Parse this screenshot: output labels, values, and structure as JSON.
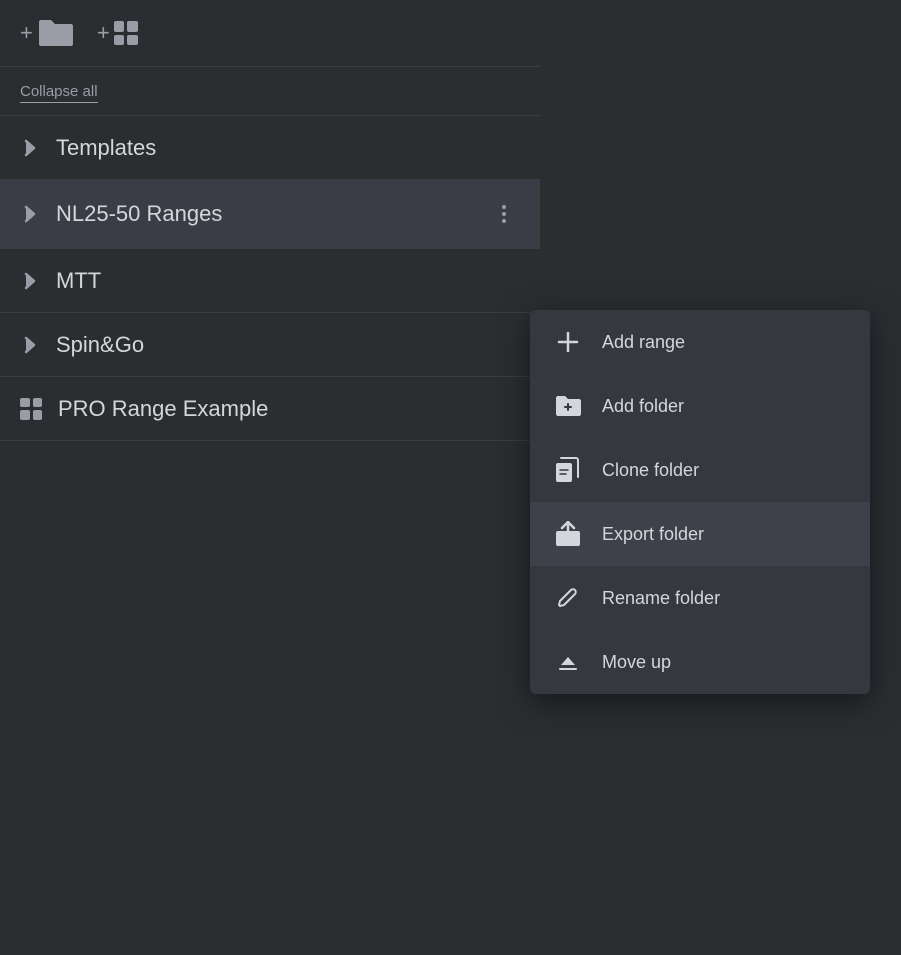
{
  "toolbar": {
    "add_folder_label": "+",
    "add_grid_label": "+"
  },
  "collapse_all": {
    "label": "Collapse all"
  },
  "nav_items": [
    {
      "id": "templates",
      "type": "chevron",
      "label": "Templates",
      "active": false,
      "show_more": false
    },
    {
      "id": "nl25-50",
      "type": "chevron",
      "label": "NL25-50 Ranges",
      "active": true,
      "show_more": true
    },
    {
      "id": "mtt",
      "type": "chevron",
      "label": "MTT",
      "active": false,
      "show_more": false
    },
    {
      "id": "spingo",
      "type": "chevron",
      "label": "Spin&Go",
      "active": false,
      "show_more": false
    },
    {
      "id": "pro-range",
      "type": "grid",
      "label": "PRO Range Example",
      "active": false,
      "show_more": false
    }
  ],
  "context_menu": {
    "items": [
      {
        "id": "add-range",
        "icon": "plus-icon",
        "label": "Add range",
        "highlighted": false
      },
      {
        "id": "add-folder",
        "icon": "add-folder-icon",
        "label": "Add folder",
        "highlighted": false
      },
      {
        "id": "clone-folder",
        "icon": "clone-folder-icon",
        "label": "Clone folder",
        "highlighted": false
      },
      {
        "id": "export-folder",
        "icon": "export-folder-icon",
        "label": "Export folder",
        "highlighted": true
      },
      {
        "id": "rename-folder",
        "icon": "rename-icon",
        "label": "Rename folder",
        "highlighted": false
      },
      {
        "id": "move-up",
        "icon": "move-up-icon",
        "label": "Move up",
        "highlighted": false
      }
    ]
  }
}
